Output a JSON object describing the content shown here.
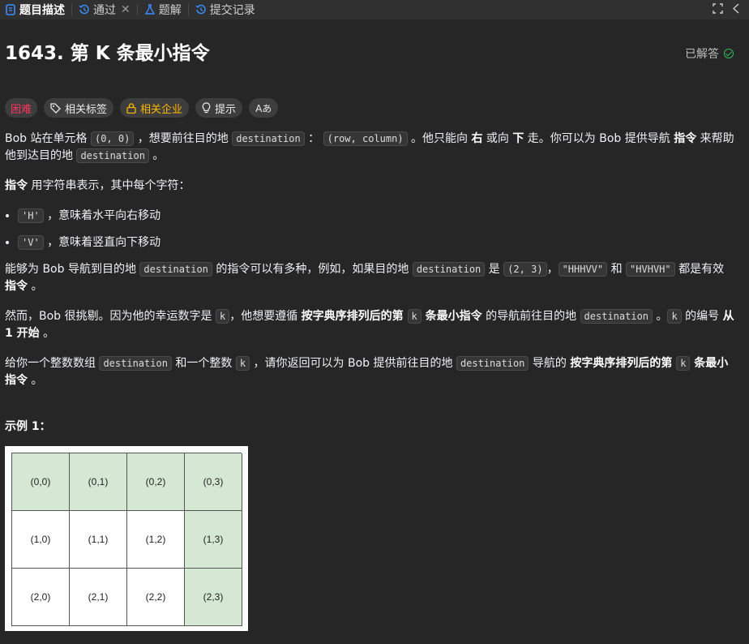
{
  "tabs": [
    {
      "label": "题目描述",
      "icon": "description-icon",
      "active": true
    },
    {
      "label": "通过",
      "icon": "history-icon",
      "closable": true
    },
    {
      "label": "题解",
      "icon": "flask-icon"
    },
    {
      "label": "提交记录",
      "icon": "history-icon"
    }
  ],
  "problem": {
    "title": "1643. 第 K 条最小指令",
    "status": "已解答"
  },
  "tags": {
    "difficulty": "困难",
    "related_tags": "相关标签",
    "related_companies": "相关企业",
    "hint": "提示",
    "font": "Aあ"
  },
  "desc": {
    "p1_a": "Bob 站在单元格 ",
    "p1_code1": "(0, 0)",
    "p1_b": " ，想要前往目的地 ",
    "p1_code2": "destination",
    "p1_c": " ： ",
    "p1_code3": "(row, column)",
    "p1_d": " 。他只能向 ",
    "p1_right": "右",
    "p1_e": " 或向 ",
    "p1_down": "下",
    "p1_f": " 走。你可以为 Bob 提供导航 ",
    "p1_instr": "指令",
    "p1_g": " 来帮助他到达目的地 ",
    "p1_code4": "destination",
    "p1_h": " 。",
    "p2_instr": "指令",
    "p2_rest": " 用字符串表示，其中每个字符：",
    "li1_code": "'H'",
    "li1_text": " ，意味着水平向右移动",
    "li2_code": "'V'",
    "li2_text": " ，意味着竖直向下移动",
    "p3_a": "能够为 Bob 导航到目的地 ",
    "p3_code1": "destination",
    "p3_b": " 的指令可以有多种，例如，如果目的地 ",
    "p3_code2": "destination",
    "p3_c": " 是 ",
    "p3_code3": "(2, 3)",
    "p3_d": "，",
    "p3_code4": "\"HHHVV\"",
    "p3_e": " 和 ",
    "p3_code5": "\"HVHVH\"",
    "p3_f": " 都是有效 ",
    "p3_instr": "指令",
    "p3_g": " 。",
    "p4_a": "然而，Bob 很挑剔。因为他的幸运数字是 ",
    "p4_k1": "k",
    "p4_b": "，他想要遵循 ",
    "p4_bold1": "按字典序排列后的第 ",
    "p4_k2": "k",
    "p4_bold2": " 条最小指令",
    "p4_c": " 的导航前往目的地 ",
    "p4_code": "destination",
    "p4_d": " 。",
    "p4_k3": "k",
    "p4_e": " 的编号 ",
    "p4_bold3": "从 1 开始",
    "p4_f": " 。",
    "p5_a": "给你一个整数数组 ",
    "p5_code1": "destination",
    "p5_b": " 和一个整数 ",
    "p5_k1": "k",
    "p5_c": " ，请你返回可以为 Bob 提供前往目的地 ",
    "p5_code2": "destination",
    "p5_d": " 导航的 ",
    "p5_bold1": "按字典序排列后的第 ",
    "p5_k2": "k",
    "p5_bold2": " 条最小指令",
    "p5_e": " 。"
  },
  "example": {
    "title": "示例 1：",
    "cells": [
      [
        "(0,0)",
        "(0,1)",
        "(0,2)",
        "(0,3)"
      ],
      [
        "(1,0)",
        "(1,1)",
        "(1,2)",
        "(1,3)"
      ],
      [
        "(2,0)",
        "(2,1)",
        "(2,2)",
        "(2,3)"
      ]
    ],
    "path_color": "#d5e8d4"
  },
  "colors": {
    "hard": "#ff375f",
    "company": "#ffb800",
    "solved": "#2cbb5d",
    "accent": "#0a84ff"
  }
}
